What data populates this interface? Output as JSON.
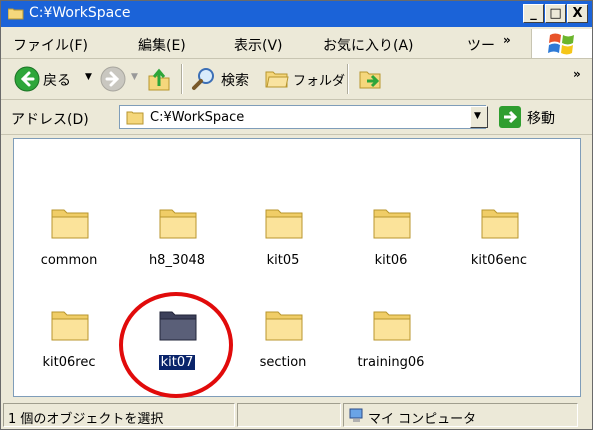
{
  "window": {
    "title": "C:¥WorkSpace"
  },
  "title_buttons": {
    "minimize": "_",
    "maximize": "□",
    "close": "X"
  },
  "menu": [
    {
      "id": "file",
      "label": "ファイル(F)"
    },
    {
      "id": "edit",
      "label": "編集(E)"
    },
    {
      "id": "view",
      "label": "表示(V)"
    },
    {
      "id": "favorites",
      "label": "お気に入り(A)"
    },
    {
      "id": "tools",
      "label": "ツー"
    }
  ],
  "menu_more": "»",
  "toolbar": {
    "back_label": "戻る",
    "search_label": "検索",
    "folders_label": "フォルダ",
    "more": "»"
  },
  "address": {
    "label": "アドレス(D)",
    "value": "C:¥WorkSpace",
    "go_label": "移動"
  },
  "folders": [
    {
      "name": "common",
      "selected": false
    },
    {
      "name": "h8_3048",
      "selected": false
    },
    {
      "name": "kit05",
      "selected": false
    },
    {
      "name": "kit06",
      "selected": false
    },
    {
      "name": "kit06enc",
      "selected": false
    },
    {
      "name": "kit06rec",
      "selected": false
    },
    {
      "name": "kit07",
      "selected": true
    },
    {
      "name": "section",
      "selected": false
    },
    {
      "name": "training06",
      "selected": false
    }
  ],
  "status": {
    "selection": "1 個のオブジェクトを選択",
    "location": "マイ コンピュータ"
  },
  "colors": {
    "titlebar": "#1b63d8",
    "folder": "#f5d77c",
    "folder_selected": "#5a5f78",
    "highlight_circle": "#e10b0b",
    "selection": "#0a246a"
  }
}
